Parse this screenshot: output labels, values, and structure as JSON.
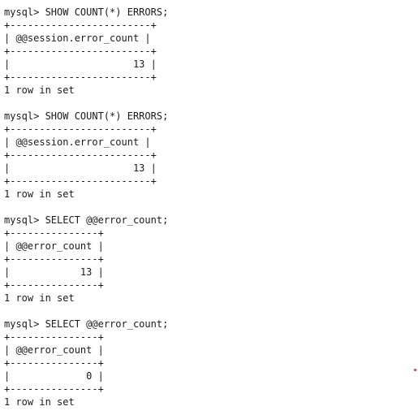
{
  "blocks": [
    {
      "prompt": "mysql> SHOW COUNT(*) ERRORS;",
      "border": "+------------------------+",
      "header": "| @@session.error_count |",
      "row": "|                     13 |",
      "footer": "1 row in set"
    },
    {
      "prompt": "mysql> SHOW COUNT(*) ERRORS;",
      "border": "+------------------------+",
      "header": "| @@session.error_count |",
      "row": "|                     13 |",
      "footer": "1 row in set"
    },
    {
      "prompt": "mysql> SELECT @@error_count;",
      "border": "+---------------+",
      "header": "| @@error_count |",
      "row": "|            13 |",
      "footer": "1 row in set"
    },
    {
      "prompt": "mysql> SELECT @@error_count;",
      "border": "+---------------+",
      "header": "| @@error_count |",
      "row": "|             0 |",
      "footer": "1 row in set"
    }
  ],
  "colors": {
    "background": "#ffffff",
    "text": "#1a1a1a",
    "stray_dot": "#e03030"
  }
}
